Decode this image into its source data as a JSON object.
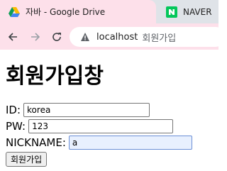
{
  "browser": {
    "tabs": [
      {
        "title": "자바 - Google Drive",
        "icon": "google-drive-icon",
        "active": true
      },
      {
        "title": "NAVER",
        "icon": "naver-icon",
        "active": false
      }
    ],
    "url_host": "localhost",
    "url_path": "회원가입"
  },
  "page": {
    "heading": "회원가입창",
    "form": {
      "id_label": "ID:",
      "id_value": "korea",
      "pw_label": "PW:",
      "pw_value": "123",
      "nickname_label": "NICKNAME:",
      "nickname_value": "a",
      "submit_label": "회원가입"
    }
  },
  "colors": {
    "tab_active_bg": "#fde0ea",
    "tabstrip_bg": "#dfe3e8",
    "naver_green": "#03c75a"
  }
}
